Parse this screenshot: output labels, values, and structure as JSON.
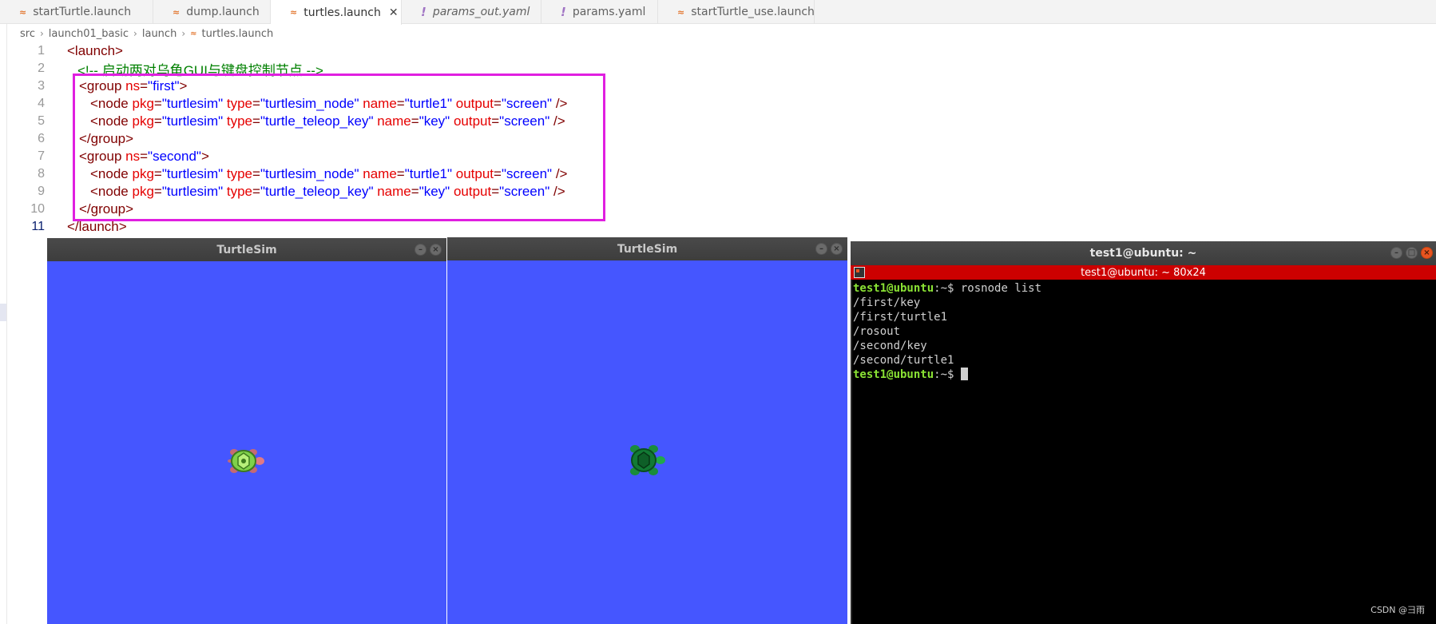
{
  "tabs": [
    {
      "label": "startTurtle.launch",
      "icon": "rss-file-icon",
      "active": false,
      "italic": false
    },
    {
      "label": "dump.launch",
      "icon": "rss-file-icon",
      "active": false,
      "italic": false
    },
    {
      "label": "turtles.launch",
      "icon": "rss-file-icon",
      "active": true,
      "italic": false
    },
    {
      "label": "params_out.yaml",
      "icon": "yaml-file-icon",
      "active": false,
      "italic": true
    },
    {
      "label": "params.yaml",
      "icon": "yaml-file-icon",
      "active": false,
      "italic": false
    },
    {
      "label": "startTurtle_use.launch",
      "icon": "rss-file-icon",
      "active": false,
      "italic": false
    }
  ],
  "breadcrumb": {
    "items": [
      "src",
      "launch01_basic",
      "launch",
      "turtles.launch"
    ]
  },
  "editor": {
    "current_line": 11,
    "lines": [
      {
        "num": "1",
        "tokens": [
          {
            "t": "tg",
            "v": "<launch>"
          }
        ]
      },
      {
        "num": "2",
        "tokens": [
          {
            "t": "cm",
            "v": "<!-- 启动两对乌龟GUI与键盘控制节点 -->"
          }
        ]
      },
      {
        "num": "3",
        "tokens": [
          {
            "t": "tg",
            "v": "<group "
          },
          {
            "t": "at",
            "v": "ns"
          },
          {
            "t": "tg",
            "v": "="
          },
          {
            "t": "vl",
            "v": "\"first\""
          },
          {
            "t": "tg",
            "v": ">"
          }
        ]
      },
      {
        "num": "4",
        "tokens": [
          {
            "t": "tg",
            "v": "<node "
          },
          {
            "t": "at",
            "v": "pkg"
          },
          {
            "t": "tg",
            "v": "="
          },
          {
            "t": "vl",
            "v": "\"turtlesim\""
          },
          {
            "t": "at",
            "v": " type"
          },
          {
            "t": "tg",
            "v": "="
          },
          {
            "t": "vl",
            "v": "\"turtlesim_node\""
          },
          {
            "t": "at",
            "v": " name"
          },
          {
            "t": "tg",
            "v": "="
          },
          {
            "t": "vl",
            "v": "\"turtle1\""
          },
          {
            "t": "at",
            "v": " output"
          },
          {
            "t": "tg",
            "v": "="
          },
          {
            "t": "vl",
            "v": "\"screen\""
          },
          {
            "t": "tg",
            "v": " />"
          }
        ]
      },
      {
        "num": "5",
        "tokens": [
          {
            "t": "tg",
            "v": "<node "
          },
          {
            "t": "at",
            "v": "pkg"
          },
          {
            "t": "tg",
            "v": "="
          },
          {
            "t": "vl",
            "v": "\"turtlesim\""
          },
          {
            "t": "at",
            "v": " type"
          },
          {
            "t": "tg",
            "v": "="
          },
          {
            "t": "vl",
            "v": "\"turtle_teleop_key\""
          },
          {
            "t": "at",
            "v": " name"
          },
          {
            "t": "tg",
            "v": "="
          },
          {
            "t": "vl",
            "v": "\"key\""
          },
          {
            "t": "at",
            "v": " output"
          },
          {
            "t": "tg",
            "v": "="
          },
          {
            "t": "vl",
            "v": "\"screen\""
          },
          {
            "t": "tg",
            "v": " />"
          }
        ]
      },
      {
        "num": "6",
        "tokens": [
          {
            "t": "tg",
            "v": "</group>"
          }
        ]
      },
      {
        "num": "7",
        "tokens": [
          {
            "t": "tg",
            "v": "<group "
          },
          {
            "t": "at",
            "v": "ns"
          },
          {
            "t": "tg",
            "v": "="
          },
          {
            "t": "vl",
            "v": "\"second\""
          },
          {
            "t": "tg",
            "v": ">"
          }
        ]
      },
      {
        "num": "8",
        "tokens": [
          {
            "t": "tg",
            "v": "<node "
          },
          {
            "t": "at",
            "v": "pkg"
          },
          {
            "t": "tg",
            "v": "="
          },
          {
            "t": "vl",
            "v": "\"turtlesim\""
          },
          {
            "t": "at",
            "v": " type"
          },
          {
            "t": "tg",
            "v": "="
          },
          {
            "t": "vl",
            "v": "\"turtlesim_node\""
          },
          {
            "t": "at",
            "v": " name"
          },
          {
            "t": "tg",
            "v": "="
          },
          {
            "t": "vl",
            "v": "\"turtle1\""
          },
          {
            "t": "at",
            "v": " output"
          },
          {
            "t": "tg",
            "v": "="
          },
          {
            "t": "vl",
            "v": "\"screen\""
          },
          {
            "t": "tg",
            "v": " />"
          }
        ]
      },
      {
        "num": "9",
        "tokens": [
          {
            "t": "tg",
            "v": "<node "
          },
          {
            "t": "at",
            "v": "pkg"
          },
          {
            "t": "tg",
            "v": "="
          },
          {
            "t": "vl",
            "v": "\"turtlesim\""
          },
          {
            "t": "at",
            "v": " type"
          },
          {
            "t": "tg",
            "v": "="
          },
          {
            "t": "vl",
            "v": "\"turtle_teleop_key\""
          },
          {
            "t": "at",
            "v": " name"
          },
          {
            "t": "tg",
            "v": "="
          },
          {
            "t": "vl",
            "v": "\"key\""
          },
          {
            "t": "at",
            "v": " output"
          },
          {
            "t": "tg",
            "v": "="
          },
          {
            "t": "vl",
            "v": "\"screen\""
          },
          {
            "t": "tg",
            "v": " />"
          }
        ]
      },
      {
        "num": "10",
        "tokens": [
          {
            "t": "tg",
            "v": "</group>"
          }
        ]
      },
      {
        "num": "11",
        "tokens": [
          {
            "t": "tg",
            "v": "</launch>"
          }
        ]
      }
    ]
  },
  "turtlesim_windows": [
    {
      "title": "TurtleSim",
      "turtle": "turtle-light-icon"
    },
    {
      "title": "TurtleSim",
      "turtle": "turtle-dark-icon"
    }
  ],
  "terminal": {
    "title": "test1@ubuntu: ~",
    "tab_label": "test1@ubuntu: ~ 80x24",
    "lines": [
      {
        "prompt_user": "test1@ubuntu",
        "prompt_rest": ":~$ ",
        "text": "rosnode list"
      },
      {
        "text": "/first/key"
      },
      {
        "text": "/first/turtle1"
      },
      {
        "text": "/rosout"
      },
      {
        "text": "/second/key"
      },
      {
        "text": "/second/turtle1"
      },
      {
        "prompt_user": "test1@ubuntu",
        "prompt_rest": ":~$ ",
        "text": "",
        "cursor": true
      }
    ]
  },
  "watermark": "CSDN @彐雨",
  "colors": {
    "turtlesim_background": "#4556ff",
    "highlight_box": "#e01fe0",
    "terminal_tab": "#cc0000",
    "prompt_green": "#8ae234"
  }
}
